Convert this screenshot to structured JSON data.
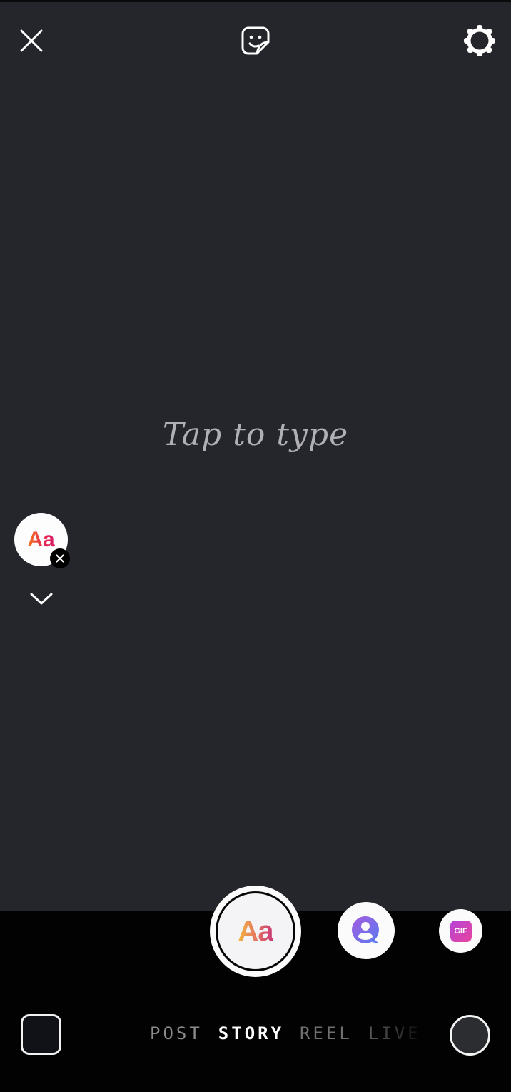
{
  "canvas": {
    "placeholder": "Tap to type",
    "background_color": "#25262c"
  },
  "top_bar": {
    "close_icon": "close-icon",
    "sticker_icon": "sticker-icon",
    "settings_icon": "settings-gear-icon"
  },
  "side_tools": {
    "font_style_label": "Aa",
    "font_style_close_icon": "close-icon",
    "expand_icon": "chevron-down-icon"
  },
  "create_modes": {
    "main_label": "Aa",
    "second_icon": "question-person-icon",
    "third_label": "GIF"
  },
  "bottom_bar": {
    "gallery_icon": "gallery-thumbnail",
    "modes": [
      {
        "label": "POST",
        "active": false
      },
      {
        "label": "STORY",
        "active": true
      },
      {
        "label": "REEL",
        "active": false
      },
      {
        "label": "LIVE",
        "active": false
      }
    ],
    "camera_switch_icon": "camera-switch-icon"
  },
  "colors": {
    "canvas_bg": "#25262c",
    "bottom_bg": "#020203",
    "accent_gradient_start": "#f47b20",
    "accent_gradient_end": "#d61e6a",
    "gif_gradient_start": "#b544d8",
    "gif_gradient_end": "#e8439e"
  }
}
